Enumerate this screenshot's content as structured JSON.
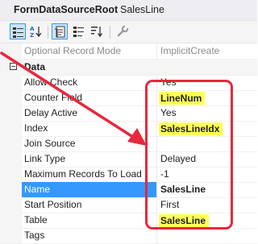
{
  "header": {
    "title_name": "FormDataSourceRoot",
    "title_value": "SalesLine"
  },
  "toolbar": {
    "buttons": [
      {
        "icon": "categorized-icon",
        "active": true
      },
      {
        "icon": "alphabetical-sort-icon",
        "active": false
      },
      {
        "icon": "properties-icon",
        "active": true
      },
      {
        "icon": "events-icon",
        "active": false
      },
      {
        "icon": "sort-order-icon",
        "active": false
      },
      {
        "icon": "wrench-icon",
        "active": false
      }
    ]
  },
  "grid": {
    "top_row": {
      "name": "Optional Record Mode",
      "value": "ImplicitCreate"
    },
    "category": "Data",
    "rows": [
      {
        "name": "Allow Check",
        "value": "Yes"
      },
      {
        "name": "Counter Field",
        "value": "LineNum"
      },
      {
        "name": "Delay Active",
        "value": "Yes"
      },
      {
        "name": "Index",
        "value": "SalesLineIdx"
      },
      {
        "name": "Join Source",
        "value": ""
      },
      {
        "name": "Link Type",
        "value": "Delayed"
      },
      {
        "name": "Maximum Records To Load",
        "value": "-1"
      },
      {
        "name": "Name",
        "value": "SalesLine"
      },
      {
        "name": "Start Position",
        "value": "First"
      },
      {
        "name": "Table",
        "value": "SalesLine"
      },
      {
        "name": "Tags",
        "value": ""
      }
    ]
  },
  "colors": {
    "selection": "#3399ff",
    "highlight": "#ffff5a",
    "annotation": "#e8283c"
  }
}
